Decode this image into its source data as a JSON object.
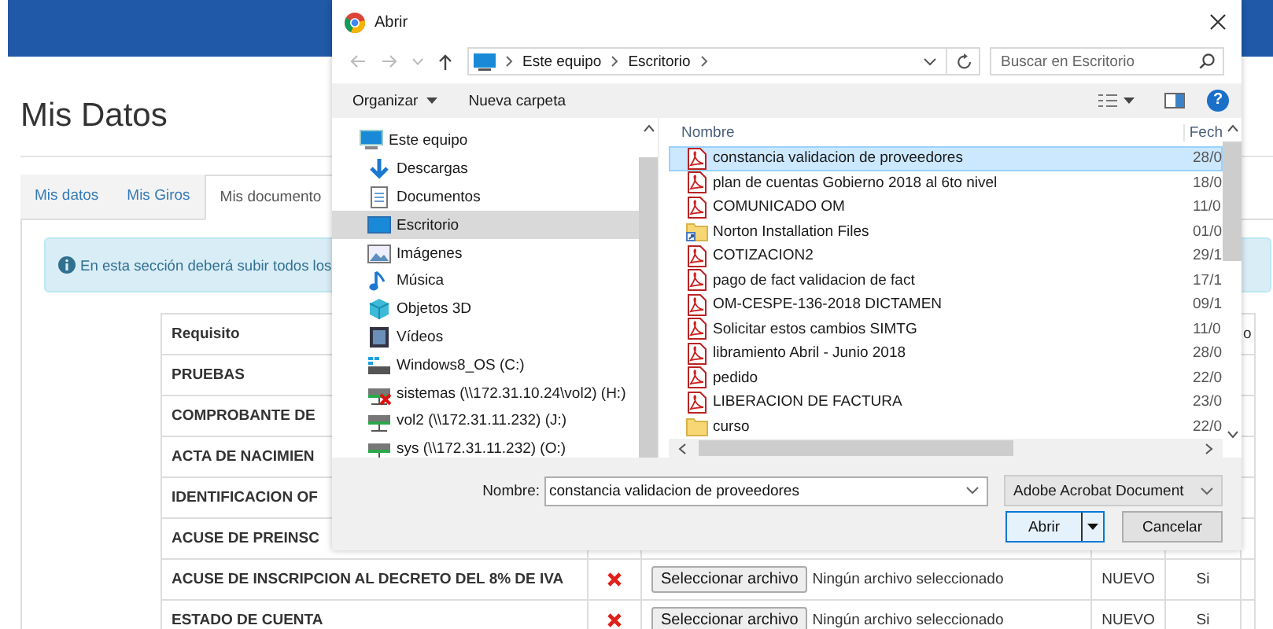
{
  "page": {
    "title": "Mis Datos",
    "tabs": [
      {
        "label": "Mis datos",
        "selected": false
      },
      {
        "label": "Mis Giros",
        "selected": false
      },
      {
        "label": "Mis documento",
        "selected": true
      }
    ],
    "alert": "En esta sección deberá subir todos los",
    "table": {
      "columns": [
        "Requisito",
        "",
        "",
        "",
        "",
        "o"
      ],
      "rows": [
        {
          "requisito": "PRUEBAS"
        },
        {
          "requisito": "COMPROBANTE DE"
        },
        {
          "requisito": "ACTA DE NACIMIEN"
        },
        {
          "requisito": "IDENTIFICACION OF"
        },
        {
          "requisito": "ACUSE DE PREINSC"
        },
        {
          "requisito": "ACUSE DE INSCRIPCION AL DECRETO DEL 8% DE IVA",
          "uploaded": false,
          "file_button": "Seleccionar archivo",
          "file_status": "Ningún archivo seleccionado",
          "estado": "NUEVO",
          "obligatorio": "Si"
        },
        {
          "requisito": "ESTADO DE CUENTA",
          "uploaded": false,
          "file_button": "Seleccionar archivo",
          "file_status": "Ningún archivo seleccionado",
          "estado": "NUEVO",
          "obligatorio": "Si"
        }
      ]
    }
  },
  "dialog": {
    "title": "Abrir",
    "breadcrumb": [
      "Este equipo",
      "Escritorio"
    ],
    "search": {
      "placeholder": "Buscar en Escritorio"
    },
    "toolbar": {
      "organize": "Organizar",
      "new_folder": "Nueva carpeta"
    },
    "nav": [
      {
        "label": "Este equipo",
        "kind": "pc",
        "selected": false,
        "children": [
          {
            "label": "Descargas",
            "kind": "downloads",
            "selected": false
          },
          {
            "label": "Documentos",
            "kind": "documents",
            "selected": false
          },
          {
            "label": "Escritorio",
            "kind": "desktop",
            "selected": true
          },
          {
            "label": "Imágenes",
            "kind": "pictures",
            "selected": false
          },
          {
            "label": "Música",
            "kind": "music",
            "selected": false
          },
          {
            "label": "Objetos 3D",
            "kind": "objects",
            "selected": false
          },
          {
            "label": "Vídeos",
            "kind": "videos",
            "selected": false
          },
          {
            "label": "Windows8_OS (C:)",
            "kind": "drive",
            "selected": false
          },
          {
            "label": "sistemas (\\\\172.31.10.24\\vol2) (H:)",
            "kind": "netdrive_off",
            "selected": false
          },
          {
            "label": "vol2 (\\\\172.31.11.232) (J:)",
            "kind": "netdrive",
            "selected": false
          },
          {
            "label": "sys (\\\\172.31.11.232) (O:)",
            "kind": "netdrive",
            "selected": false
          }
        ]
      }
    ],
    "columns": [
      "Nombre",
      "Fech"
    ],
    "files": [
      {
        "name": "constancia validacion de proveedores",
        "date": "28/0",
        "kind": "pdf",
        "selected": true
      },
      {
        "name": "plan de cuentas Gobierno 2018 al 6to nivel",
        "date": "18/0",
        "kind": "pdf",
        "selected": false
      },
      {
        "name": "COMUNICADO OM",
        "date": "11/0",
        "kind": "pdf",
        "selected": false
      },
      {
        "name": "Norton Installation Files",
        "date": "01/0",
        "kind": "shortcut",
        "selected": false
      },
      {
        "name": "COTIZACION2",
        "date": "29/1",
        "kind": "pdf",
        "selected": false
      },
      {
        "name": "pago de fact validacion de fact",
        "date": "17/1",
        "kind": "pdf",
        "selected": false
      },
      {
        "name": "OM-CESPE-136-2018 DICTAMEN",
        "date": "09/1",
        "kind": "pdf",
        "selected": false
      },
      {
        "name": "Solicitar estos cambios SIMTG",
        "date": "11/0",
        "kind": "pdf",
        "selected": false
      },
      {
        "name": "libramiento Abril - Junio 2018",
        "date": "28/0",
        "kind": "pdf",
        "selected": false
      },
      {
        "name": "pedido",
        "date": "22/0",
        "kind": "pdf",
        "selected": false
      },
      {
        "name": "LIBERACION DE FACTURA",
        "date": "23/0",
        "kind": "pdf",
        "selected": false
      },
      {
        "name": "curso",
        "date": "22/0",
        "kind": "folder",
        "selected": false
      }
    ],
    "filename_label": "Nombre:",
    "filename": "constancia validacion de proveedores",
    "filetype": "Adobe Acrobat Document",
    "help": "?",
    "buttons": {
      "open": "Abrir",
      "cancel": "Cancelar"
    }
  }
}
